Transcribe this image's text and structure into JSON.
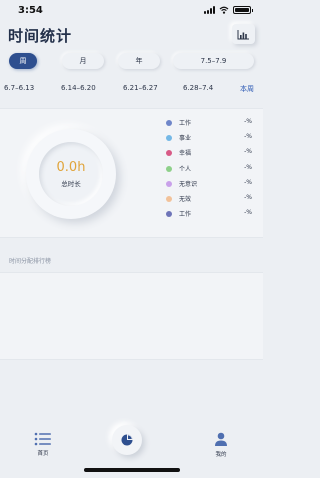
{
  "status_bar": {
    "time": "3:54"
  },
  "header": {
    "title": "时间统计",
    "chart_icon": "bar-chart-icon"
  },
  "periods": [
    {
      "label": "周",
      "active": true
    },
    {
      "label": "月",
      "active": false
    },
    {
      "label": "年",
      "active": false
    },
    {
      "label": "7.5–7.9",
      "active": false
    }
  ],
  "weeks": [
    "6.7–6.13",
    "6.14–6.20",
    "6.21–6.27",
    "6.28–7.4",
    "本周"
  ],
  "summary": {
    "total_value": "0.0h",
    "total_label": "总时长"
  },
  "legend": [
    {
      "label": "工作",
      "value": "-%",
      "color": "#6f86c9"
    },
    {
      "label": "事业",
      "value": "-%",
      "color": "#74b8e6"
    },
    {
      "label": "幸福",
      "value": "-%",
      "color": "#d85a86"
    },
    {
      "label": "个人",
      "value": "-%",
      "color": "#8ed08a"
    },
    {
      "label": "无意识",
      "value": "-%",
      "color": "#c9a1ea"
    },
    {
      "label": "无效",
      "value": "-%",
      "color": "#f2c29a"
    },
    {
      "label": "工作",
      "value": "-%",
      "color": "#6e74b8"
    }
  ],
  "ranking": {
    "title": "时间分配排行榜"
  },
  "tabbar": {
    "home_label": "首页",
    "me_label": "我的"
  }
}
